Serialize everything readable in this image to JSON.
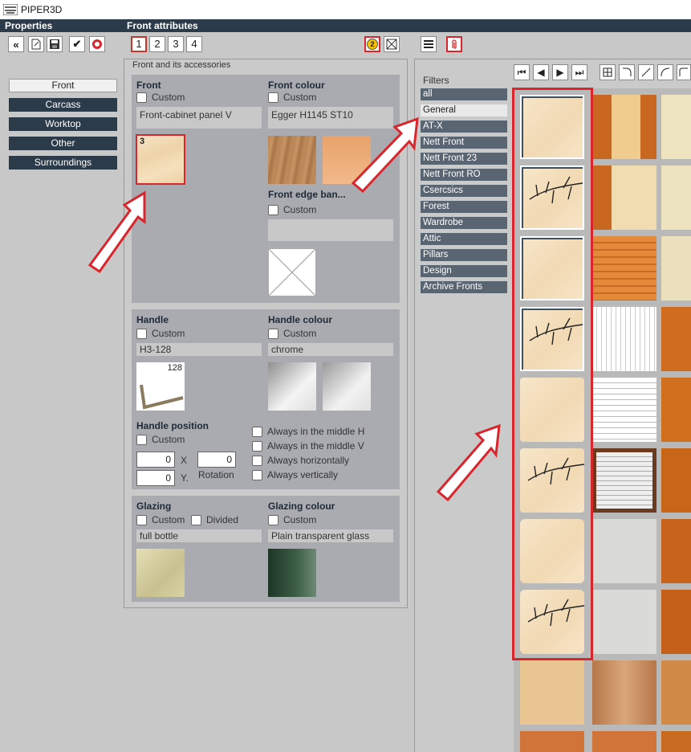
{
  "window": {
    "title": "PIPER3D"
  },
  "sections": {
    "properties": "Properties",
    "front_attributes": "Front attributes"
  },
  "toolbar": {
    "tabs": [
      "1",
      "2",
      "3",
      "4"
    ],
    "help_badge": "2"
  },
  "nav": {
    "items": [
      "Front",
      "Carcass",
      "Worktop",
      "Other",
      "Surroundings"
    ]
  },
  "panel": {
    "caption": "Front and its accessories",
    "front": {
      "label": "Front",
      "custom": "Custom",
      "value": "Front-cabinet panel V",
      "tile_number": "3"
    },
    "front_colour": {
      "label": "Front colour",
      "custom": "Custom",
      "value": "Egger H1145 ST10"
    },
    "front_edge": {
      "label": "Front edge ban...",
      "custom": "Custom",
      "value": ""
    },
    "handle": {
      "label": "Handle",
      "custom": "Custom",
      "value": "H3-128",
      "size": "128"
    },
    "handle_colour": {
      "label": "Handle colour",
      "custom": "Custom",
      "value": "chrome"
    },
    "handle_position": {
      "label": "Handle position",
      "custom": "Custom",
      "x_value": "0",
      "x_label": "X",
      "y_value": "0",
      "y_label": "Y.",
      "rotation_value": "0",
      "rotation_label": "Rotation",
      "options": [
        "Always in the middle H",
        "Always in the middle V",
        "Always horizontally",
        "Always vertically"
      ]
    },
    "glazing": {
      "label": "Glazing",
      "custom": "Custom",
      "divided": "Divided",
      "value": "full bottle"
    },
    "glazing_colour": {
      "label": "Glazing colour",
      "custom": "Custom",
      "value": "Plain transparent glass"
    }
  },
  "filters": {
    "title": "Filters",
    "items": [
      "all",
      "General",
      "AT-X",
      "Nett Front",
      "Nett Front 23",
      "Nett Front RO",
      "Csercsics",
      "Forest",
      "Wardrobe",
      "Attic",
      "Pillars",
      "Design",
      "Archive Fronts"
    ],
    "selected": "General"
  },
  "colors": {
    "accent": "#2c3b4a",
    "highlight": "#d9262c"
  }
}
